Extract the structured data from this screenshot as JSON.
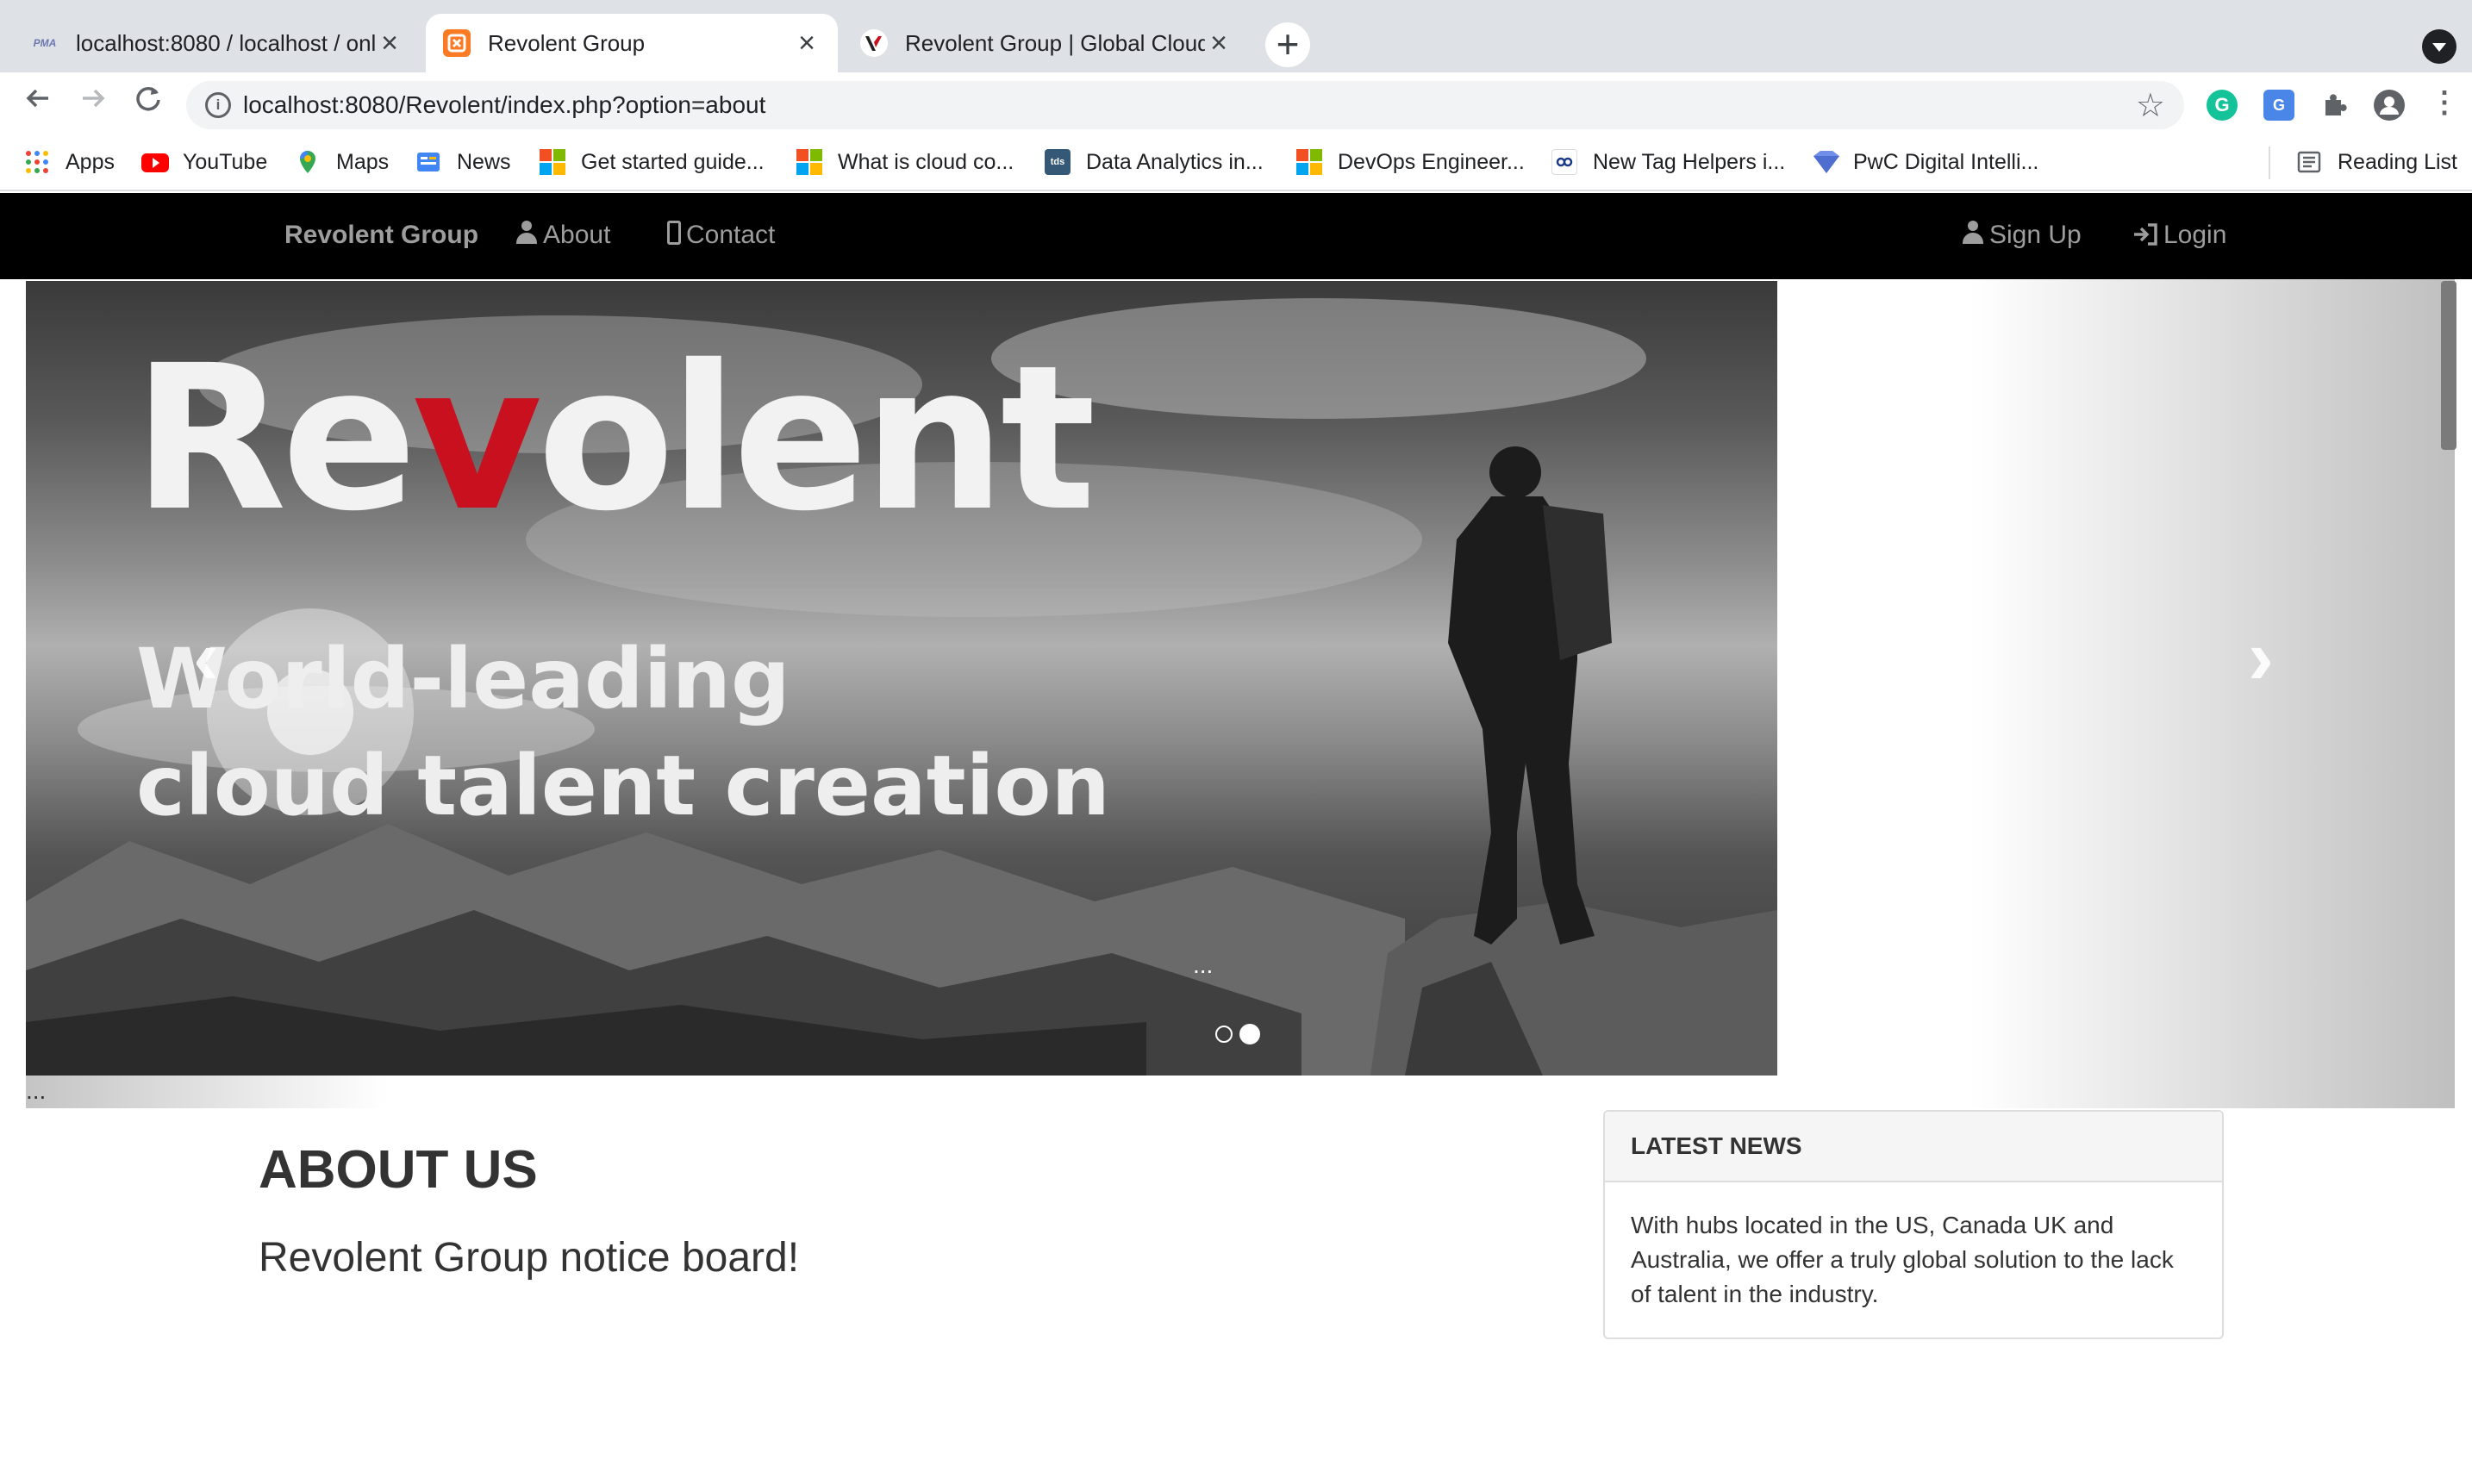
{
  "browser": {
    "tabs": [
      {
        "title": "localhost:8080 / localhost / onl",
        "favicon": "phpmyadmin-icon",
        "active": false
      },
      {
        "title": "Revolent Group",
        "favicon": "xampp-icon",
        "active": true
      },
      {
        "title": "Revolent Group | Global Cloud",
        "favicon": "revolent-icon",
        "active": false
      }
    ],
    "url": "localhost:8080/Revolent/index.php?option=about",
    "bookmarks": [
      {
        "label": "Apps",
        "icon": "apps-grid-icon"
      },
      {
        "label": "YouTube",
        "icon": "youtube-icon"
      },
      {
        "label": "Maps",
        "icon": "maps-icon"
      },
      {
        "label": "News",
        "icon": "news-icon"
      },
      {
        "label": "Get started guide...",
        "icon": "microsoft-icon"
      },
      {
        "label": "What is cloud co...",
        "icon": "microsoft-icon"
      },
      {
        "label": "Data Analytics in...",
        "icon": "tds-icon"
      },
      {
        "label": "DevOps Engineer...",
        "icon": "microsoft-icon"
      },
      {
        "label": "New Tag Helpers i...",
        "icon": "link-icon"
      },
      {
        "label": "PwC Digital Intelli...",
        "icon": "pwc-icon"
      }
    ],
    "reading_list": "Reading List",
    "favicon_text": {
      "tds": "tds",
      "pma": "PMA"
    }
  },
  "site": {
    "brand": "Revolent Group",
    "nav": {
      "about": "About",
      "contact": "Contact",
      "signup": "Sign Up",
      "login": "Login"
    },
    "carousel": {
      "logo_text": "Re",
      "logo_v": "v",
      "logo_rest": "olent",
      "tagline_1": "World-leading",
      "tagline_2": "cloud talent creation",
      "caption": "...",
      "below_caption": "...",
      "prev": "‹",
      "next": "›",
      "active_slide": 2,
      "slide_count": 2
    },
    "about_heading": "ABOUT US",
    "about_subheading": "Revolent Group notice board!",
    "news": {
      "heading": "LATEST NEWS",
      "body": "With hubs located in the US, Canada UK and Australia, we offer a truly global solution to the lack of talent in the industry."
    },
    "colors": {
      "navbar": "#000000",
      "nav_text": "#9d9d9d",
      "brand_red": "#c8101e"
    }
  }
}
